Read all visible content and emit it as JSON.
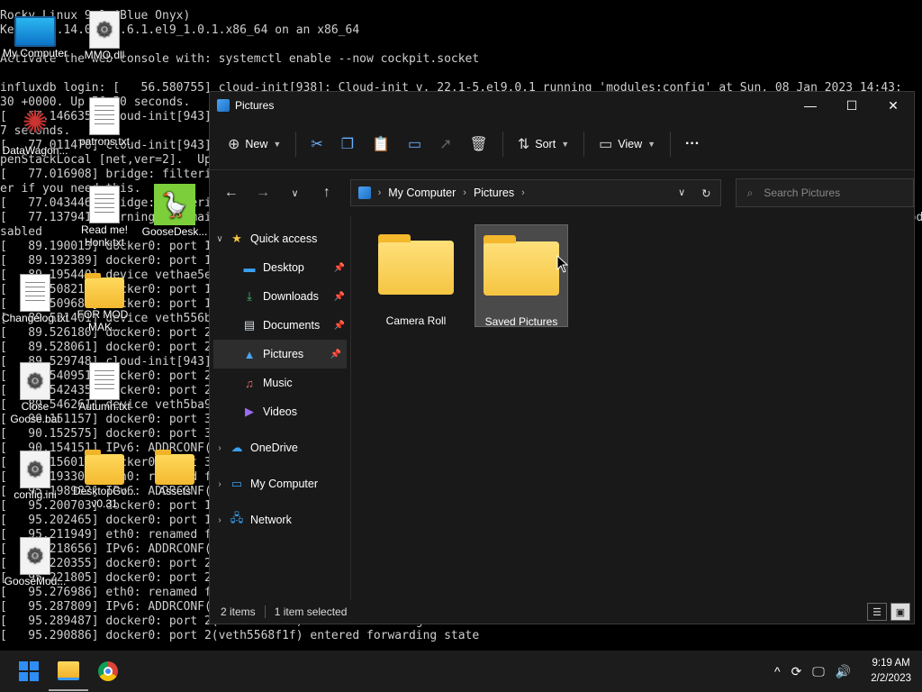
{
  "terminal": {
    "lines": [
      "Rocky Linux 9.1 (Blue Onyx)",
      "Kernel 5.14.0-162.6.1.el9_1.0.1.x86_64 on an x86_64",
      "",
      "Activate the web console with: systemctl enable --now cockpit.socket",
      "",
      "influxdb login: [   56.580755] cloud-init[938]: Cloud-init v. 22.1-5.el9.0.1 running 'modules:config' at Sun, 08 Jan 2023 14:43:",
      "30 +0000. Up 56.50 seconds.",
      "[   57.146635] cloud-init[943]: Cloud-init v. 22.1-5.el9.0.1 finished at Sun, 08 Jan 2023 14:43:31 +0000. Datasource DataSource",
      "7 seconds.",
      "[   77.011476] cloud-init[943]: Cloud-init v. 22.1-5.el9.0.1 finished at Sun, 08 Jan 2023 14:43:31 +0000. Datasource DataSourceO",
      "penStackLocal [net,ver=2].  Up 77.01 seconds",
      "[   77.016908] bridge: filtering via arp/ip/ip6tables is no longer available by default. Update your scripts to load br_netfilt",
      "er if you need this.",
      "[   77.043446] bridge: filtering via arp/ip/ip6tables is no longer available by default.",
      "[   77.137941] warning: `[email protected]` uses legacy ethtool link settings API, link modes are only partially reported. Link modes are only partially di",
      "sabled",
      "[   89.190013] docker0: port 1(veth01e3b41) entered blocking state",
      "[   89.192389] docker0: port 1(veth01e3b41) entered disabled state",
      "[   89.195440] device vethae5e4c0 entered promiscuous mode",
      "[   89.508211] docker0: port 1(veth01e3b41) entered blocking state",
      "[   89.509684] docker0: port 1(veth01e3b41) entered forwarding state",
      "[   89.521401] device veth556b5ba entered promiscuous mode",
      "[   89.526180] docker0: port 2(veth5568f1f) entered blocking state",
      "[   89.528061] docker0: port 2(veth5568f1f) entered disabled state",
      "[   89.529748] cloud-init[943]: Cloud-init v. 22.1-5.el9.0.1 finished",
      "[   89.540951] docker0: port 2(veth5568f1f) entered blocking state",
      "[   89.542435] docker0: port 2(veth5568f1f) entered forwarding state",
      "[   89.546261] device veth5ba9e10 entered promiscuous mode",
      "[   90.151157] docker0: port 3(veth5ba9e10) entered blocking state",
      "[   90.152575] docker0: port 3(veth5ba9e10) entered disabled state",
      "[   90.154151] IPv6: ADDRCONF(NETDEV_CHANGE): veth5ba9e10: link becomes ready",
      "[   90.156017] docker0: port 3(veth5ba9e10) entered blocking state",
      "[   90.193305] eth0: renamed from veth01e3b41",
      "[   95.198982] IPv6: ADDRCONF(NETDEV_CHANGE): veth01e3b41: link becomes ready",
      "[   95.200703] docker0: port 1(veth01e3b41) entered blocking state",
      "[   95.202465] docker0: port 1(veth01e3b41) entered forwarding state",
      "[   95.211949] eth0: renamed from veth556b5ba",
      "[   95.218656] IPv6: ADDRCONF(NETDEV_CHANGE): veth556b5ba: link becomes ready",
      "[   95.220355] docker0: port 2(veth5568f1f) entered blocking state",
      "[   95.221805] docker0: port 2(veth5568f1f) entered forwarding state",
      "[   95.276986] eth0: renamed from veth5ba9e10",
      "[   95.287809] IPv6: ADDRCONF(NETDEV_CHANGE): veth5ba9e10: link becomes ready",
      "[   95.289487] docker0: port 2(veth5568f1f) entered blocking state",
      "[   95.290886] docker0: port 2(veth5568f1f) entered forwarding state"
    ]
  },
  "desktop_icons": [
    {
      "label": "My Computer",
      "kind": "monitor"
    },
    {
      "label": "MMO.dll",
      "kind": "gear"
    },
    {
      "label": "DataWagon...",
      "kind": "shortcut"
    },
    {
      "label": "patrons.txt",
      "kind": "doc"
    },
    {
      "label": "Read me!",
      "kind": "doc"
    },
    {
      "label": "GooseDesk...",
      "kind": "goose"
    },
    {
      "label": "Honk.txt",
      "kind": "hidden"
    },
    {
      "label": "Changelog.txt",
      "kind": "doc"
    },
    {
      "label": "FOR MOD-MAK...",
      "kind": "folder"
    },
    {
      "label": "Close Goose.bat",
      "kind": "gear"
    },
    {
      "label": "Autumn.txt",
      "kind": "doc"
    },
    {
      "label": "config.ini",
      "kind": "gear"
    },
    {
      "label": "DesktopGo... v0.31",
      "kind": "folder"
    },
    {
      "label": "Assets",
      "kind": "folder"
    },
    {
      "label": "GooseMod...",
      "kind": "gear"
    }
  ],
  "explorer": {
    "title": "Pictures",
    "controls": {
      "minimize": "—",
      "maximize": "☐",
      "close": "✕"
    },
    "toolbar": {
      "new_label": "New",
      "sort_label": "Sort",
      "view_label": "View",
      "more_label": "···"
    },
    "address": {
      "crumbs": [
        "My Computer",
        "Pictures"
      ]
    },
    "search_placeholder": "Search Pictures",
    "nav": {
      "quick_access": "Quick access",
      "quick_items": [
        {
          "label": "Desktop",
          "icon": "desktop-icon",
          "pinned": true
        },
        {
          "label": "Downloads",
          "icon": "download-icon",
          "pinned": true
        },
        {
          "label": "Documents",
          "icon": "documents-icon",
          "pinned": true
        },
        {
          "label": "Pictures",
          "icon": "pictures-icon",
          "pinned": true
        },
        {
          "label": "Music",
          "icon": "music-icon",
          "pinned": false
        },
        {
          "label": "Videos",
          "icon": "videos-icon",
          "pinned": false
        }
      ],
      "onedrive": "OneDrive",
      "my_computer": "My Computer",
      "network": "Network"
    },
    "items": [
      {
        "label": "Camera Roll",
        "selected": false
      },
      {
        "label": "Saved Pictures",
        "selected": true
      }
    ],
    "status": {
      "count": "2 items",
      "selected": "1 item selected"
    }
  },
  "taskbar": {
    "time": "9:19 AM",
    "date": "2/2/2023",
    "chevron": "^"
  },
  "colors": {
    "window_bg": "#191919",
    "accent": "#2e8ef6",
    "folder": "#f5c542"
  }
}
